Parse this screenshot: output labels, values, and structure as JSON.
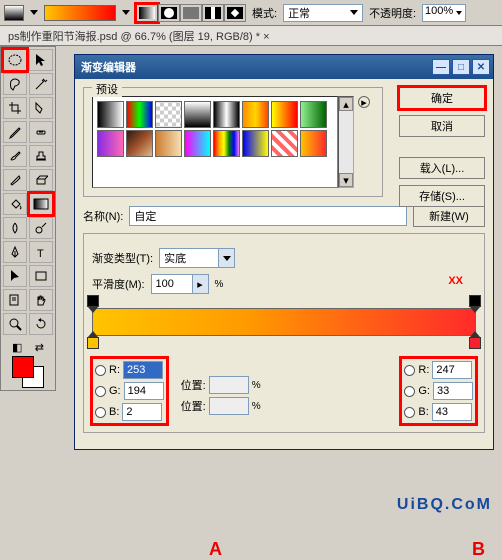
{
  "topbar": {
    "mode_label": "模式:",
    "mode_value": "正常",
    "opacity_label": "不透明度:",
    "opacity_value": "100%"
  },
  "doc_tab": "ps制作重阳节海报.psd @ 66.7% (图层 19, RGB/8) * ×",
  "dialog": {
    "title": "渐变编辑器",
    "presets_label": "预设",
    "ok": "确定",
    "cancel": "取消",
    "load": "载入(L)...",
    "save": "存储(S)...",
    "name_label": "名称(N):",
    "name_value": "自定",
    "new_btn": "新建(W)",
    "type_label": "渐变类型(T):",
    "type_value": "实底",
    "smooth_label": "平滑度(M):",
    "smooth_value": "100",
    "percent": "%",
    "marker_a": "A",
    "marker_b": "B",
    "pos_label": "位置:",
    "rgbA": {
      "r_lbl": "R:",
      "g_lbl": "G:",
      "b_lbl": "B:",
      "r": "253",
      "g": "194",
      "b": "2"
    },
    "rgbB": {
      "r_lbl": "R:",
      "g_lbl": "G:",
      "b_lbl": "B:",
      "r": "247",
      "g": "33",
      "b": "43"
    },
    "xx": "XX"
  },
  "watermark": "UiBQ.CoM",
  "chart_data": {
    "type": "gradient",
    "stops": [
      {
        "pos": 0,
        "rgb": [
          253,
          194,
          2
        ],
        "label": "A"
      },
      {
        "pos": 100,
        "rgb": [
          247,
          33,
          43
        ],
        "label": "B"
      }
    ]
  }
}
